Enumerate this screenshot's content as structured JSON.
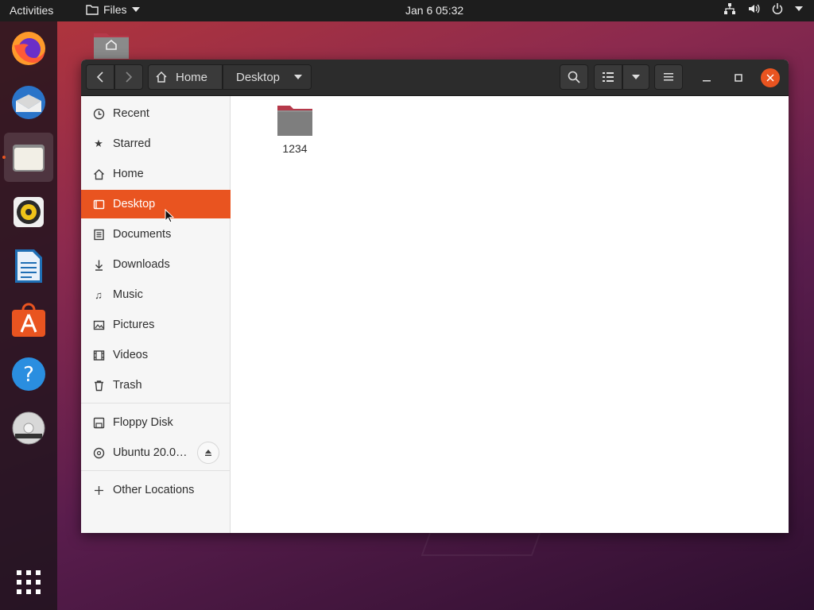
{
  "topbar": {
    "activities": "Activities",
    "app_name": "Files",
    "clock": "Jan 6  05:32"
  },
  "dock": {
    "items": [
      {
        "name": "firefox-icon"
      },
      {
        "name": "thunderbird-icon"
      },
      {
        "name": "files-icon",
        "active": true
      },
      {
        "name": "rhythmbox-icon"
      },
      {
        "name": "libreoffice-writer-icon"
      },
      {
        "name": "ubuntu-software-icon"
      },
      {
        "name": "help-icon"
      },
      {
        "name": "dvd-icon"
      },
      {
        "name": "show-applications-icon"
      }
    ]
  },
  "window": {
    "path": {
      "home": "Home",
      "current": "Desktop"
    },
    "sidebar": {
      "places": [
        {
          "label": "Recent",
          "icon": "clock-icon"
        },
        {
          "label": "Starred",
          "icon": "star-icon"
        },
        {
          "label": "Home",
          "icon": "home-icon"
        },
        {
          "label": "Desktop",
          "icon": "desktop-icon",
          "selected": true
        },
        {
          "label": "Documents",
          "icon": "document-icon"
        },
        {
          "label": "Downloads",
          "icon": "download-icon"
        },
        {
          "label": "Music",
          "icon": "music-icon"
        },
        {
          "label": "Pictures",
          "icon": "picture-icon"
        },
        {
          "label": "Videos",
          "icon": "video-icon"
        },
        {
          "label": "Trash",
          "icon": "trash-icon"
        }
      ],
      "devices": [
        {
          "label": "Floppy Disk",
          "icon": "floppy-icon"
        },
        {
          "label": "Ubuntu 20.0…",
          "icon": "disc-icon",
          "ejectable": true
        }
      ],
      "other": {
        "label": "Other Locations",
        "icon": "plus-icon"
      }
    },
    "files": [
      {
        "label": "1234",
        "icon": "folder-icon"
      }
    ]
  },
  "colors": {
    "accent": "#e95420",
    "headerbar": "#2c2c2c",
    "topbar": "#1d1d1d"
  }
}
